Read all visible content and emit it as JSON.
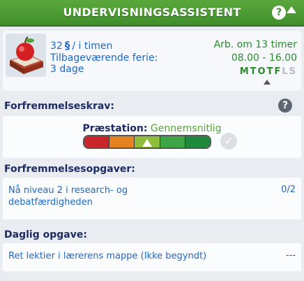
{
  "header": {
    "title": "UNDERVISNINGSASSISTENT",
    "help_label": "?",
    "accent": "#4b9a32"
  },
  "info": {
    "pay_amount": "32",
    "currency_symbol": "§",
    "pay_unit": "/ i timen",
    "vacation_label": "Tilbageværende ferie:",
    "vacation_value": "3 dage",
    "work_in": "Arb. om 13 timer",
    "hours": "08.00 - 16.00",
    "days": [
      {
        "label": "M",
        "active": true
      },
      {
        "label": "T",
        "active": true
      },
      {
        "label": "O",
        "active": true
      },
      {
        "label": "T",
        "active": true
      },
      {
        "label": "F",
        "active": true
      },
      {
        "label": "L",
        "active": false
      },
      {
        "label": "S",
        "active": false
      }
    ]
  },
  "promotion": {
    "section_label": "Forfremmelseskrav:",
    "help_label": "?",
    "performance_label": "Præstation:",
    "performance_value": "Gennemsnitlig",
    "performance_level": 0.5,
    "bar_colors": [
      "#c8262a",
      "#e58220",
      "#8fbf3a",
      "#3ea546",
      "#1f8a3b"
    ]
  },
  "tasks": {
    "section_label": "Forfremmelsesopgaver:",
    "items": [
      {
        "text_line1": "Nå niveau 2 i research- og",
        "text_line2": "debatfærdigheden",
        "progress": "0/2"
      }
    ]
  },
  "daily": {
    "section_label": "Daglig opgave:",
    "text": "Ret lektier i lærerens mappe (Ikke begyndt)",
    "progress": "---"
  }
}
